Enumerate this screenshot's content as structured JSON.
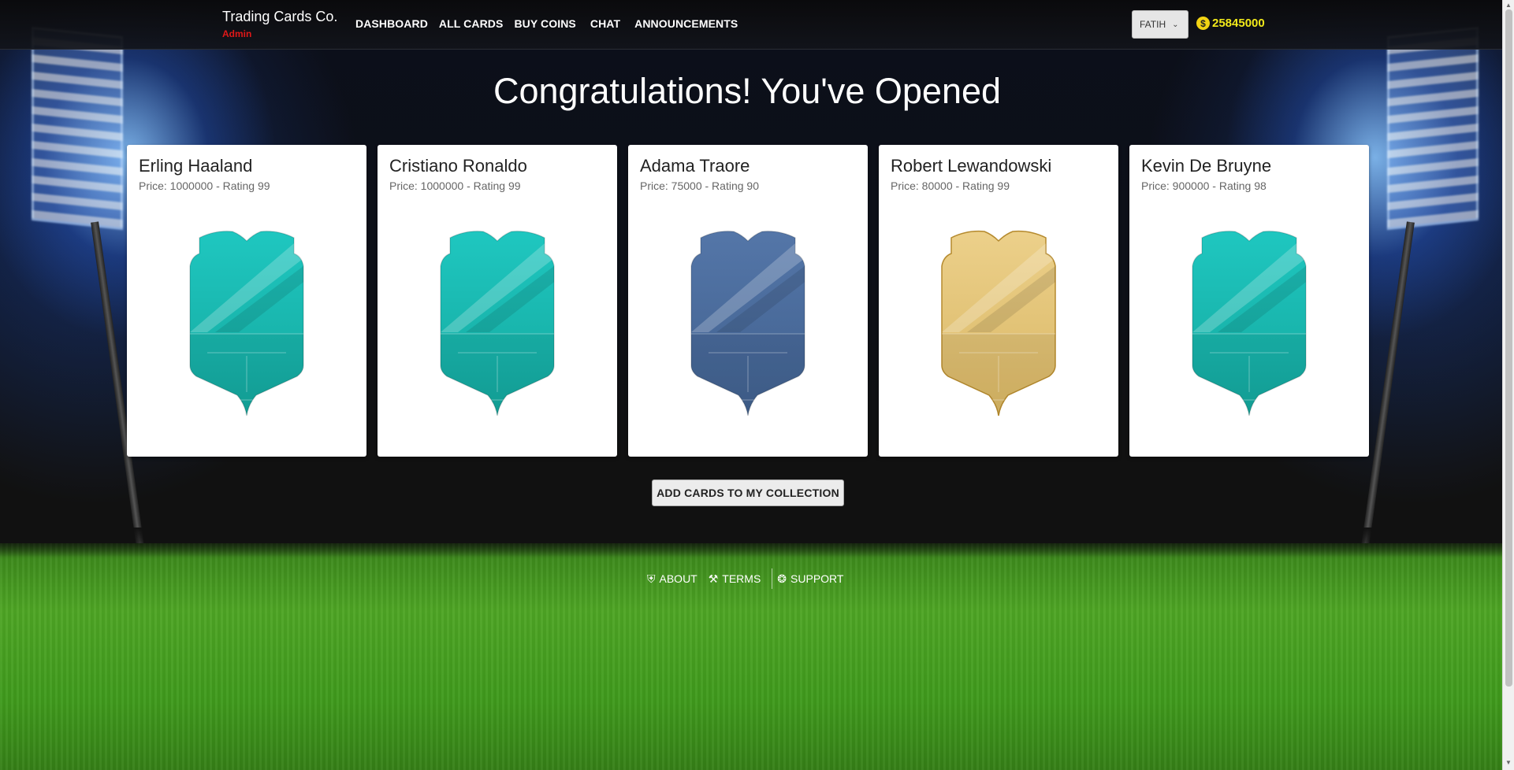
{
  "navbar": {
    "brand": "Trading Cards Co.",
    "role": "Admin",
    "links": [
      "DASHBOARD",
      "ALL CARDS",
      "BUY COINS",
      "CHAT",
      "ANNOUNCEMENTS"
    ],
    "user": "FATIH",
    "coins": "25845000"
  },
  "page": {
    "title": "Congratulations! You've Opened"
  },
  "cards": [
    {
      "name": "Erling Haaland",
      "meta": "Price: 1000000 - Rating 99",
      "style": "teal"
    },
    {
      "name": "Cristiano Ronaldo",
      "meta": "Price: 1000000 - Rating 99",
      "style": "teal"
    },
    {
      "name": "Adama Traore",
      "meta": "Price: 75000 - Rating 90",
      "style": "blue"
    },
    {
      "name": "Robert Lewandowski",
      "meta": "Price: 80000 - Rating 99",
      "style": "gold"
    },
    {
      "name": "Kevin De Bruyne",
      "meta": "Price: 900000 - Rating 98",
      "style": "teal"
    }
  ],
  "actions": {
    "add_to_collection": "ADD CARDS TO MY COLLECTION"
  },
  "footer": {
    "about": "ABOUT",
    "terms": "TERMS",
    "support": "SUPPORT"
  },
  "colors": {
    "teal_top": "#1fc7c0",
    "teal_bottom": "#14a79d",
    "blue_top": "#5476a8",
    "blue_bottom": "#40608e",
    "gold_top": "#ecd08a",
    "gold_bottom": "#d9b765",
    "coin": "#f2ea1a",
    "admin": "#e01818"
  }
}
